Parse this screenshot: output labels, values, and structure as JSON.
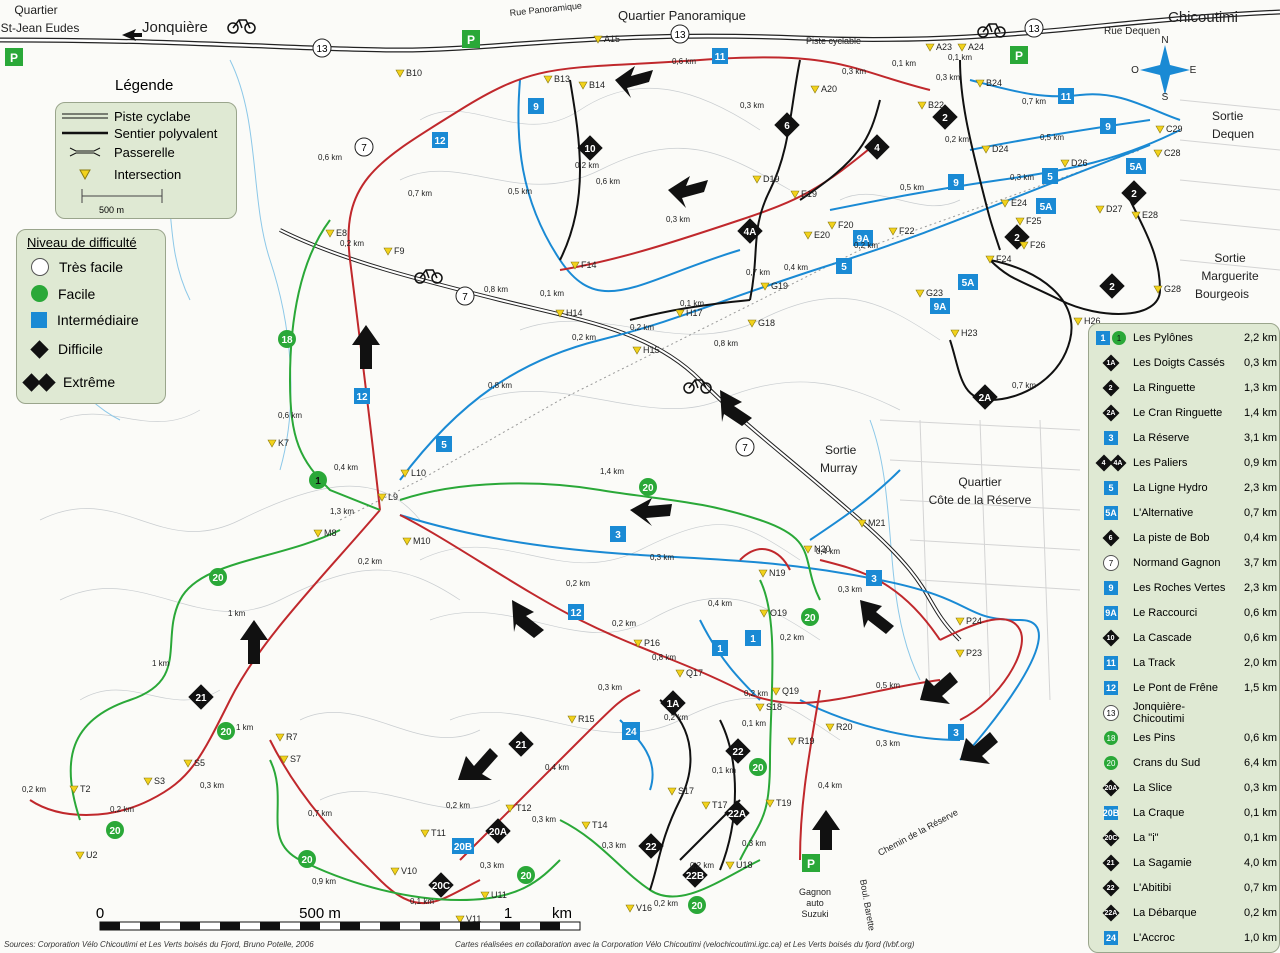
{
  "places": {
    "st_jean": [
      "Quartier",
      "St-Jean Eudes"
    ],
    "jonquiere": "Jonquière",
    "panoramique": "Quartier Panoramique",
    "rue_panoramique": "Rue Panoramique",
    "chicoutimi": "Chicoutimi",
    "rue_dequen": "Rue Dequen",
    "sortie_dequen": [
      "Sortie",
      "Dequen"
    ],
    "sortie_marguerite": [
      "Sortie",
      "Marguerite",
      "Bourgeois"
    ],
    "sortie_murray": [
      "Sortie",
      "Murray"
    ],
    "cote_reserve": [
      "Quartier",
      "Côte de la Réserve"
    ],
    "chemin_reserve": "Chemin de la Réserve",
    "gagnon": [
      "Gagnon",
      "auto",
      "Suzuki"
    ],
    "boul_barette": "Boul. Barette",
    "piste_cyclable": "Piste cyclable"
  },
  "compass": {
    "n": "N",
    "s": "S",
    "e": "E",
    "o": "O"
  },
  "legend": {
    "title": "Légende",
    "items": [
      "Piste cyclabe",
      "Sentier polyvalent",
      "Passerelle",
      "Intersection"
    ],
    "scale": "500 m"
  },
  "difficulty": {
    "title": "Niveau de difficulté",
    "levels": [
      "Très facile",
      "Facile",
      "Intermédiaire",
      "Difficile",
      "Extrême"
    ]
  },
  "colors": {
    "blue": "#1a8ad4",
    "green": "#2aa838",
    "red": "#c0282c",
    "black": "#111111",
    "route": "#b02a6a",
    "bg_panel": "#dfe9d3"
  },
  "trails": [
    {
      "badges": [
        "sq:1",
        "ci:1"
      ],
      "name": "Les Pylônes",
      "len": "2,2 km"
    },
    {
      "badges": [
        "dm:1A"
      ],
      "name": "Les Doigts Cassés",
      "len": "0,3 km"
    },
    {
      "badges": [
        "dm:2"
      ],
      "name": "La Ringuette",
      "len": "1,3 km"
    },
    {
      "badges": [
        "dm:2A"
      ],
      "name": "Le Cran Ringuette",
      "len": "1,4 km"
    },
    {
      "badges": [
        "sq:3"
      ],
      "name": "La Réserve",
      "len": "3,1 km"
    },
    {
      "badges": [
        "dm:4",
        "dm:4A"
      ],
      "name": "Les Paliers",
      "len": "0,9 km"
    },
    {
      "badges": [
        "sq:5"
      ],
      "name": "La Ligne Hydro",
      "len": "2,3 km"
    },
    {
      "badges": [
        "sq:5A"
      ],
      "name": "L'Alternative",
      "len": "0,7 km"
    },
    {
      "badges": [
        "dm:6"
      ],
      "name": "La piste de Bob",
      "len": "0,4 km"
    },
    {
      "badges": [
        "wc:7"
      ],
      "name": "Normand Gagnon",
      "len": "3,7 km"
    },
    {
      "badges": [
        "sq:9"
      ],
      "name": "Les Roches Vertes",
      "len": "2,3 km"
    },
    {
      "badges": [
        "sq:9A"
      ],
      "name": "Le Raccourci",
      "len": "0,6 km"
    },
    {
      "badges": [
        "dm:10"
      ],
      "name": "La Cascade",
      "len": "0,6 km"
    },
    {
      "badges": [
        "sq:11"
      ],
      "name": "La Track",
      "len": "2,0 km"
    },
    {
      "badges": [
        "sq:12"
      ],
      "name": "Le Pont de Frêne",
      "len": "1,5 km"
    },
    {
      "badges": [
        "wc:13"
      ],
      "name": "Jonquière-Chicoutimi",
      "len": ""
    },
    {
      "badges": [
        "ci:18"
      ],
      "name": "Les Pins",
      "len": "0,6 km"
    },
    {
      "badges": [
        "ci:20"
      ],
      "name": "Crans du Sud",
      "len": "6,4 km"
    },
    {
      "badges": [
        "dm:20A"
      ],
      "name": "La Slice",
      "len": "0,3 km"
    },
    {
      "badges": [
        "sq:20B"
      ],
      "name": "La Craque",
      "len": "0,1 km"
    },
    {
      "badges": [
        "dm:20C"
      ],
      "name": "La \"i\"",
      "len": "0,1 km"
    },
    {
      "badges": [
        "dm:21"
      ],
      "name": "La Sagamie",
      "len": "4,0 km"
    },
    {
      "badges": [
        "dm:22"
      ],
      "name": "L'Abitibi",
      "len": "0,7 km"
    },
    {
      "badges": [
        "dm:22A"
      ],
      "name": "La Débarque",
      "len": "0,2 km"
    },
    {
      "badges": [
        "sq:24"
      ],
      "name": "L'Accroc",
      "len": "1,0 km"
    }
  ],
  "intersections": [
    "A15",
    "A20",
    "A23",
    "A24",
    "B10",
    "B13",
    "B14",
    "B22",
    "B24",
    "C28",
    "C29",
    "D19",
    "D24",
    "D26",
    "D27",
    "E8",
    "E19",
    "E20",
    "E24",
    "E28",
    "F9",
    "F14",
    "F20",
    "F22",
    "F24",
    "F25",
    "F26",
    "G18",
    "G19",
    "G23",
    "G28",
    "H14",
    "H15",
    "H17",
    "H23",
    "H26",
    "K7",
    "L9",
    "L10",
    "M8",
    "M10",
    "M21",
    "N19",
    "N20",
    "O19",
    "P16",
    "P23",
    "P24",
    "Q17",
    "Q19",
    "R7",
    "R15",
    "R19",
    "R20",
    "S3",
    "S5",
    "S7",
    "S17",
    "S18",
    "T2",
    "T12",
    "T14",
    "T17",
    "T19",
    "U2",
    "U11",
    "U18",
    "V10",
    "V11",
    "V16",
    "T11"
  ],
  "distances": [
    "0,6 km",
    "0,3 km",
    "0,1 km",
    "0,1 km",
    "0,3 km",
    "0,7 km",
    "0,5 km",
    "0,2 km",
    "0,3 km",
    "0,5 km",
    "0,2 km",
    "0,6 km",
    "0,6 km",
    "0,7 km",
    "0,3 km",
    "0,2 km",
    "0,5 km",
    "0,3 km",
    "0,7 km",
    "0,2 km",
    "0,8 km",
    "0,1 km",
    "0,2 km",
    "0,1 km",
    "0,4 km",
    "0,2 km",
    "0,8 km",
    "0,8 km",
    "0,6 km",
    "0,4 km",
    "1,4 km",
    "1 km",
    "0,3 km",
    "1 km",
    "1,3 km",
    "0,2 km",
    "0,3 km",
    "0,4 km",
    "0,2 km",
    "0,8 km",
    "0,2 km",
    "0,5 km",
    "0,3 km",
    "0,2 km",
    "0,4 km",
    "1 km",
    "0,7 km",
    "0,2 km",
    "0,3 km",
    "0,3 km",
    "0,9 km",
    "0,1 km",
    "0,3 km",
    "0,2 km",
    "0,4 km",
    "0,4 km",
    "0,7 km",
    "0,2 km",
    "0,3 km",
    "0,2 km",
    "0,3 km",
    "0,1 km",
    "0,2 km",
    "0,1 km",
    "0,2 km",
    "0,2 km",
    "0,3 km"
  ],
  "scalebar": {
    "zero": "0",
    "mid": "500 m",
    "one": "1",
    "unit": "km"
  },
  "credits": {
    "sources": "Sources: Corporation Vélo Chicoutimi et Les Verts boisés du Fjord, Bruno Potelle, 2006",
    "made": "Cartes réalisées en collaboration avec la Corporation Vélo Chicoutimi  (velochicoutimi.igc.ca) et Les Verts boisés du fjord (lvbf.org)"
  },
  "parking": "P",
  "road_numbers": [
    "13",
    "13",
    "13",
    "7",
    "7",
    "7"
  ]
}
